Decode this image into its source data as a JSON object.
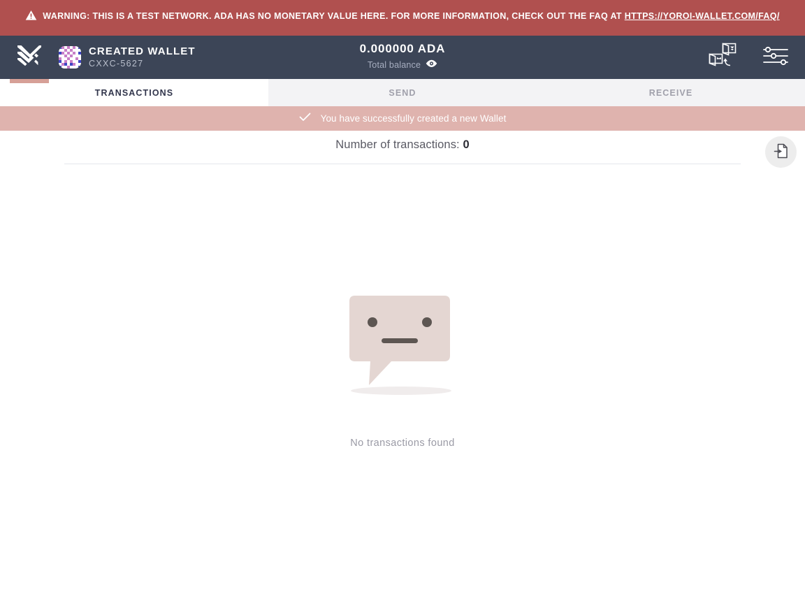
{
  "warning": {
    "icon": "warning-triangle-icon",
    "text": "WARNING: THIS IS A TEST NETWORK. ADA HAS NO MONETARY VALUE HERE. FOR MORE INFORMATION, CHECK OUT THE FAQ AT ",
    "link_text": "HTTPS://YOROI-WALLET.COM/FAQ/",
    "background_color": "#b0504f"
  },
  "navbar": {
    "logo_icon": "yoroi-logo-icon",
    "avatar_icon": "wallet-identicon-avatar",
    "wallet_name": "CREATED WALLET",
    "wallet_plate": "CXXC-5627",
    "balance_amount": "0.000000 ADA",
    "balance_label": "Total balance",
    "balance_toggle_icon": "eye-icon",
    "wallet_switch_icon": "wallet-switch-icon",
    "settings_icon": "settings-sliders-icon",
    "background_color": "#3c4557",
    "accent_color": "#d6a097"
  },
  "tabs": [
    {
      "label": "TRANSACTIONS",
      "active": true
    },
    {
      "label": "SEND",
      "active": false
    },
    {
      "label": "RECEIVE",
      "active": false
    }
  ],
  "notification": {
    "icon": "check-icon",
    "text": "You have successfully created a new Wallet",
    "background_color": "#dfb3ae"
  },
  "transactions": {
    "count_label": "Number of transactions: ",
    "count_value": "0",
    "export_icon": "export-document-icon"
  },
  "empty_state": {
    "illustration": "neutral-face-speech-bubble-illustration",
    "text": "No transactions found"
  }
}
